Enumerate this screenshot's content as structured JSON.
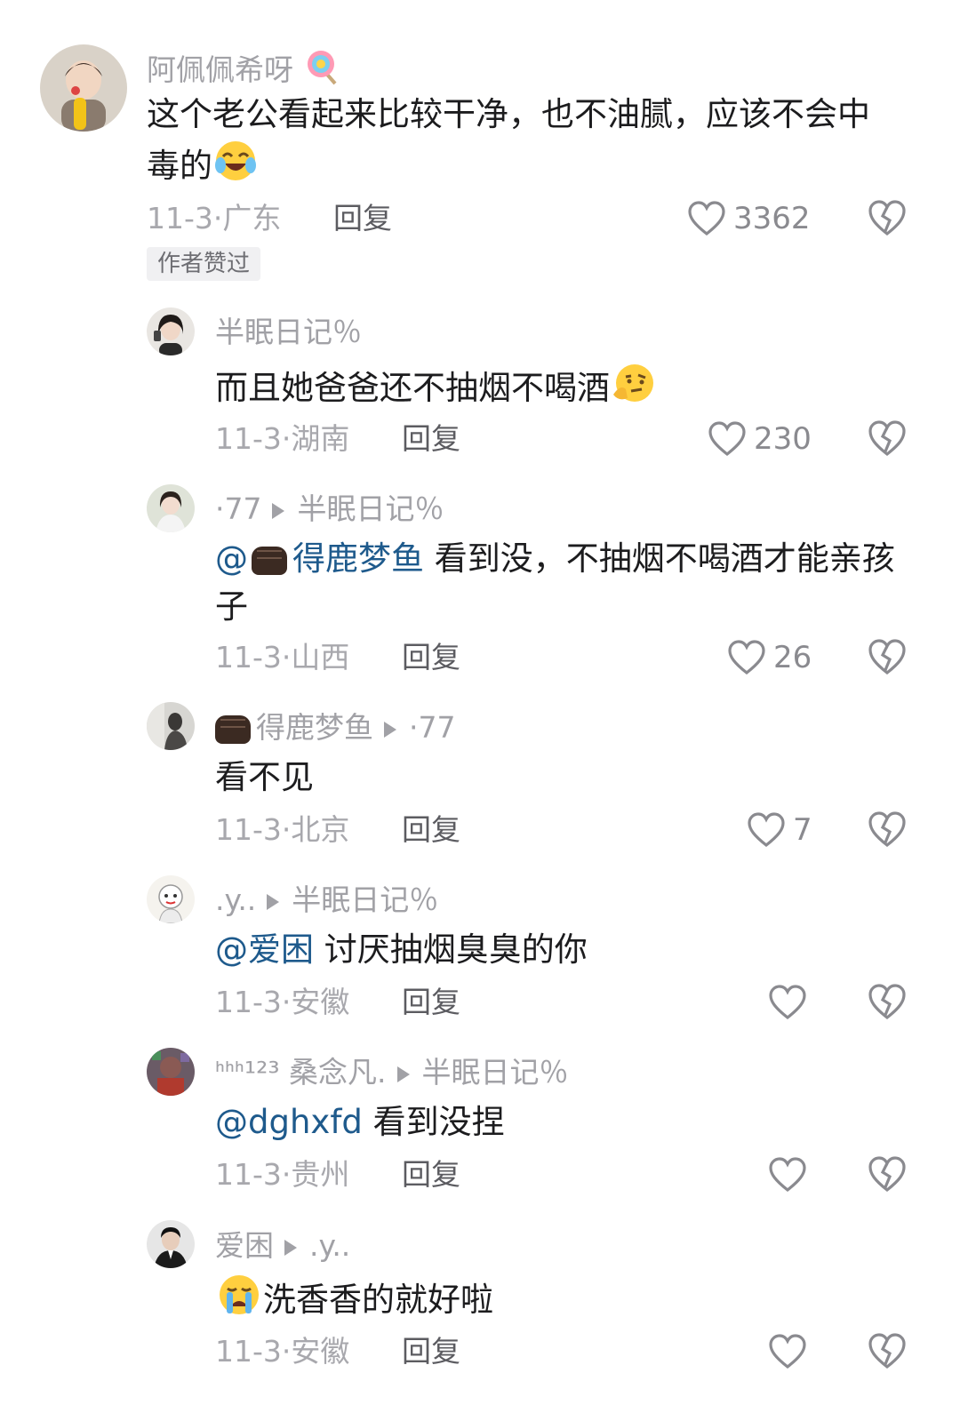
{
  "comments": [
    {
      "user": "阿佩佩希呀",
      "text": "这个老公看起来比较干净，也不油腻，应该不会中毒的",
      "date": "11-3",
      "location": "广东",
      "reply_label": "回复",
      "likes": "3362",
      "badge": "作者赞过"
    },
    {
      "user": "半眠日记％",
      "text": "而且她爸爸还不抽烟不喝酒",
      "date": "11-3",
      "location": "湖南",
      "reply_label": "回复",
      "likes": "230"
    },
    {
      "user": "·77",
      "reply_to": "半眠日记％",
      "mention": "@",
      "mention_name": "得鹿梦鱼",
      "text": " 看到没，不抽烟不喝酒才能亲孩子",
      "date": "11-3",
      "location": "山西",
      "reply_label": "回复",
      "likes": "26"
    },
    {
      "user": "得鹿梦鱼",
      "reply_to": "·77",
      "text": "看不见",
      "date": "11-3",
      "location": "北京",
      "reply_label": "回复",
      "likes": "7"
    },
    {
      "user": ".y..",
      "reply_to": "半眠日记％",
      "mention": "@爱困",
      "text": " 讨厌抽烟臭臭的你",
      "date": "11-3",
      "location": "安徽",
      "reply_label": "回复",
      "likes": ""
    },
    {
      "user": "ᑋᑋᑋ¹²³ 桑念凡.",
      "reply_to": "半眠日记％",
      "mention": "@dghxfd",
      "text": " 看到没捏",
      "date": "11-3",
      "location": "贵州",
      "reply_label": "回复",
      "likes": ""
    },
    {
      "user": "爱困",
      "reply_to": ".y..",
      "text": "洗香香的就好啦",
      "date": "11-3",
      "location": "安徽",
      "reply_label": "回复",
      "likes": ""
    }
  ],
  "icons": {
    "like": "heart-outline-icon",
    "dislike": "broken-heart-icon",
    "reply_arrow": "triangle-right-icon"
  },
  "colors": {
    "mention": "#1e5a8c",
    "meta": "#a8a8ad",
    "username": "#a1a1a6"
  }
}
